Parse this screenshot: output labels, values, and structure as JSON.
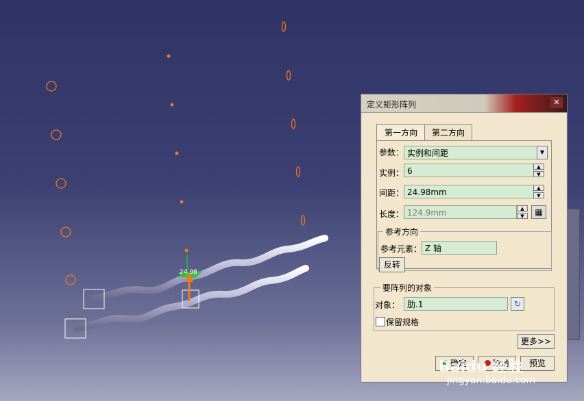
{
  "dialog": {
    "title": "定义矩形阵列",
    "close_label": "✕",
    "tabs": [
      "第一方向",
      "第二方向"
    ],
    "params_label": "参数：",
    "params_value": "实例和间距",
    "instances_label": "实例：",
    "instances_value": "6",
    "spacing_label": "间距：",
    "spacing_value": "24.98mm",
    "length_label": "长度：",
    "length_value": "124.9mm",
    "ref_group": "参考方向",
    "ref_element_label": "参考元素：",
    "ref_element_value": "Z 轴",
    "reverse_label": "反转",
    "objects_group": "要阵列的对象",
    "object_label": "对象：",
    "object_value": "肋.1",
    "keep_spec_label": "保留规格",
    "more_label": "更多>>",
    "ok_label": "确定",
    "cancel_label": "取消",
    "preview_label": "预览"
  },
  "compass": {
    "label": "24.98"
  },
  "watermark": {
    "line1": "Baidu 经验",
    "line2": "jingyan.baidu.com"
  },
  "colors": {
    "accent_orange": "#f07a1a",
    "field_green": "#d6ecd2",
    "dialog_bg": "#f2e6cc"
  }
}
